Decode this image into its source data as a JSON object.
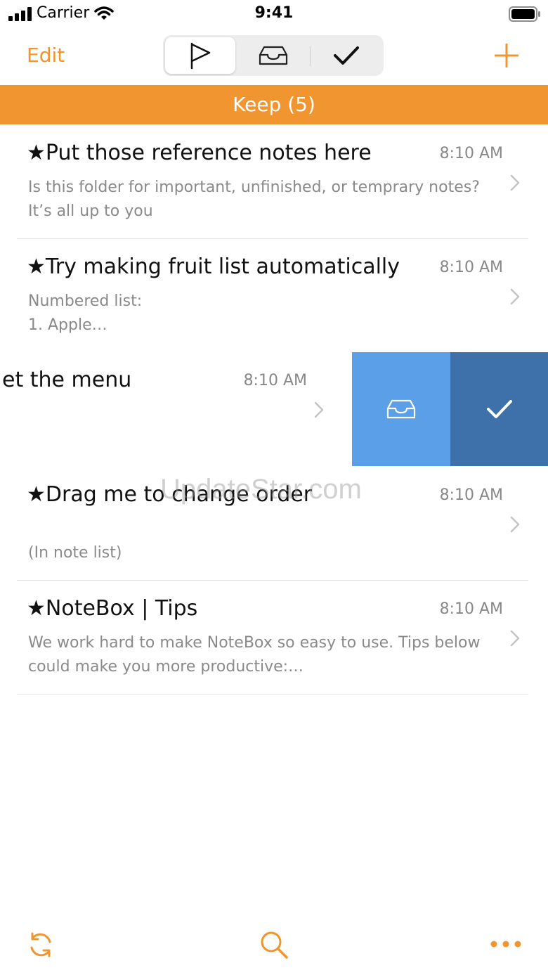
{
  "status_bar": {
    "carrier": "Carrier",
    "time": "9:41"
  },
  "nav": {
    "edit_label": "Edit",
    "segments": [
      "flag-icon",
      "inbox-icon",
      "checkmark-icon"
    ],
    "selected_segment": 0,
    "add_icon": "plus-icon"
  },
  "banner": {
    "title": "Keep (5)"
  },
  "notes": [
    {
      "title": "★Put those reference notes here",
      "time": "8:10 AM",
      "snippet": "Is this folder for important, unfinished, or temprary notes? It’s all up to you"
    },
    {
      "title": "★Try making fruit list automatically",
      "time": "8:10 AM",
      "snippet": "Numbered list:\n1. Apple…"
    },
    {
      "title": "et the menu",
      "time": "8:10 AM",
      "snippet": ""
    },
    {
      "title": "★Drag me to change order",
      "time": "8:10 AM",
      "snippet": "\n(In note list)"
    },
    {
      "title": "★NoteBox | Tips",
      "time": "8:10 AM",
      "snippet": "We work hard to make NoteBox so easy to use. Tips below could make you more productive:…"
    }
  ],
  "swipe_actions": [
    "inbox-icon",
    "checkmark-icon"
  ],
  "watermark": "UpdateStar.com",
  "toolbar": {
    "items": [
      "sync-icon",
      "search-icon",
      "more-icon"
    ]
  },
  "colors": {
    "accent": "#F0952F",
    "action_inbox": "#5B9FE8",
    "action_done": "#3E70A9",
    "secondary_text": "#8a8a8a"
  }
}
